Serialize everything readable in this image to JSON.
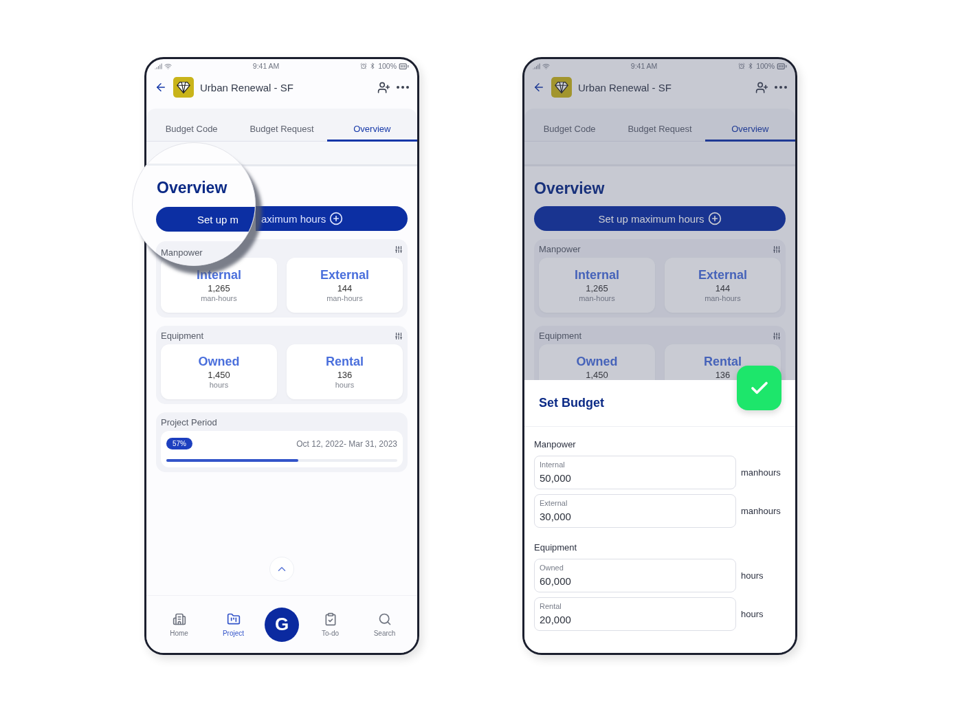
{
  "left_phone": {
    "status_bar": {
      "time": "9:41 AM",
      "battery": "100%"
    },
    "header": {
      "title": "Urban Renewal - SF"
    },
    "tabs": [
      {
        "label": "Budget Code",
        "selected": false
      },
      {
        "label": "Budget Request",
        "selected": false
      },
      {
        "label": "Overview",
        "selected": true
      }
    ],
    "action_button": {
      "label": "aximum hours"
    },
    "panels": [
      {
        "cards": [
          {
            "label": "Internal",
            "value": "1,265",
            "unit": "man-hours"
          },
          {
            "label": "External",
            "value": "144",
            "unit": "man-hours"
          }
        ]
      },
      {
        "title": "Equipment",
        "cards": [
          {
            "label": "Owned",
            "value": "1,450",
            "unit": "hours"
          },
          {
            "label": "Rental",
            "value": "136",
            "unit": "hours"
          }
        ]
      }
    ],
    "project_period": {
      "title": "Project Period",
      "badge": "57%",
      "dates": "Oct 12, 2022- Mar 31, 2023",
      "level": 0.57
    },
    "nav": [
      {
        "label": "Home",
        "selected": false
      },
      {
        "label": "Project",
        "selected": true
      },
      {
        "label": "To-do",
        "selected": false
      },
      {
        "label": "Search",
        "selected": false
      }
    ],
    "center_button": {
      "label": "G"
    },
    "magnifier": {
      "title": "Overview",
      "button_label": "Set up m",
      "section_label": "Manpower"
    }
  },
  "right_phone": {
    "status_bar": {
      "time": "9:41 AM",
      "battery": "100%"
    },
    "header": {
      "title": "Urban Renewal - SF"
    },
    "tabs": [
      {
        "label": "Budget Code",
        "selected": false
      },
      {
        "label": "Budget Request",
        "selected": false
      },
      {
        "label": "Overview",
        "selected": true
      }
    ],
    "heading": "Overview",
    "action_button": {
      "label": "Set up maximum hours"
    },
    "panels": [
      {
        "title": "Manpower",
        "cards": [
          {
            "label": "Internal",
            "value": "1,265",
            "unit": "man-hours"
          },
          {
            "label": "External",
            "value": "144",
            "unit": "man-hours"
          }
        ]
      },
      {
        "title": "Equipment",
        "cards": [
          {
            "label": "Owned",
            "value": "1,450"
          },
          {
            "label": "Rental",
            "value": "136"
          }
        ]
      }
    ],
    "sheet": {
      "title": "Set Budget",
      "groups": [
        {
          "title": "Manpower",
          "fields": [
            {
              "label": "Internal",
              "value": "50,000",
              "unit": "manhours"
            },
            {
              "label": "External",
              "value": "30,000",
              "unit": "manhours"
            }
          ]
        },
        {
          "title": "Equipment",
          "fields": [
            {
              "label": "Owned",
              "value": "60,000",
              "unit": "hours"
            },
            {
              "label": "Rental",
              "value": "20,000",
              "unit": "hours"
            }
          ]
        }
      ]
    }
  }
}
